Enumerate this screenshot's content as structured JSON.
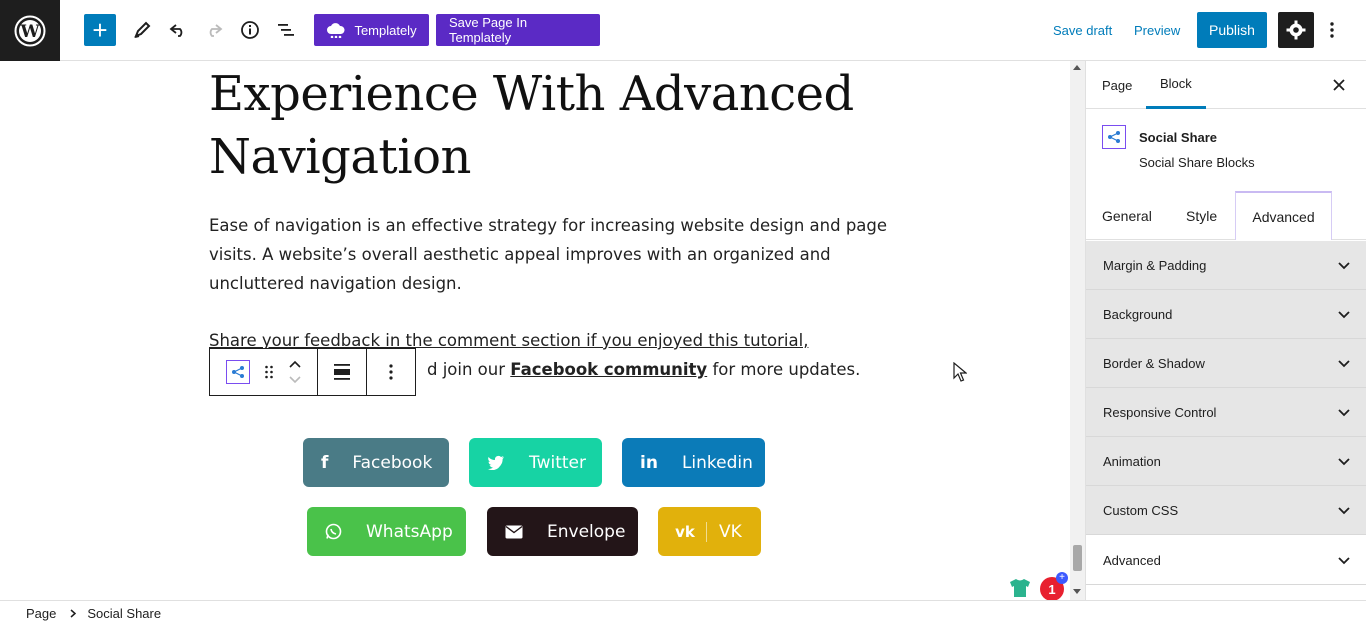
{
  "toolbar": {
    "templately_label": "Templately",
    "save_templately_label": "Save Page In Templately",
    "save_draft_label": "Save draft",
    "preview_label": "Preview",
    "publish_label": "Publish"
  },
  "content": {
    "title_lines": [
      "Experience With Advanced",
      "Navigation"
    ],
    "para1": "Ease of navigation is an effective strategy for increasing website design and page visits. A website’s overall aesthetic appeal improves with an organized and uncluttered navigation design.",
    "para2_line1": "Share your feedback in the comment section if you enjoyed this tutorial,",
    "para2_pre": "d join our",
    "para2_link": "Facebook community",
    "para2_post": "for more updates."
  },
  "share_buttons": [
    {
      "label": "Facebook",
      "color": "#4a7b86",
      "icon": "facebook-icon"
    },
    {
      "label": "Twitter",
      "color": "#17d3a4",
      "icon": "twitter-icon"
    },
    {
      "label": "Linkedin",
      "color": "#0b7bb8",
      "icon": "linkedin-icon"
    },
    {
      "label": "WhatsApp",
      "color": "#4ac24a",
      "icon": "whatsapp-icon"
    },
    {
      "label": "Envelope",
      "color": "#231518",
      "icon": "envelope-icon"
    },
    {
      "label": "VK",
      "color": "#e1b10c",
      "icon": "vk-icon"
    }
  ],
  "sidebar": {
    "tabs": [
      "Page",
      "Block"
    ],
    "block_name": "Social Share",
    "block_sub": "Social Share Blocks",
    "panel_tabs": [
      "General",
      "Style",
      "Advanced"
    ],
    "panels": [
      "Margin & Padding",
      "Background",
      "Border & Shadow",
      "Responsive Control",
      "Animation",
      "Custom CSS",
      "Advanced"
    ]
  },
  "notification_count": "1",
  "breadcrumb": [
    "Page",
    "Social Share"
  ],
  "colors": {
    "accent": "#007cba",
    "templately_purple": "#5b2ac5",
    "dark": "#1e1e1e"
  }
}
